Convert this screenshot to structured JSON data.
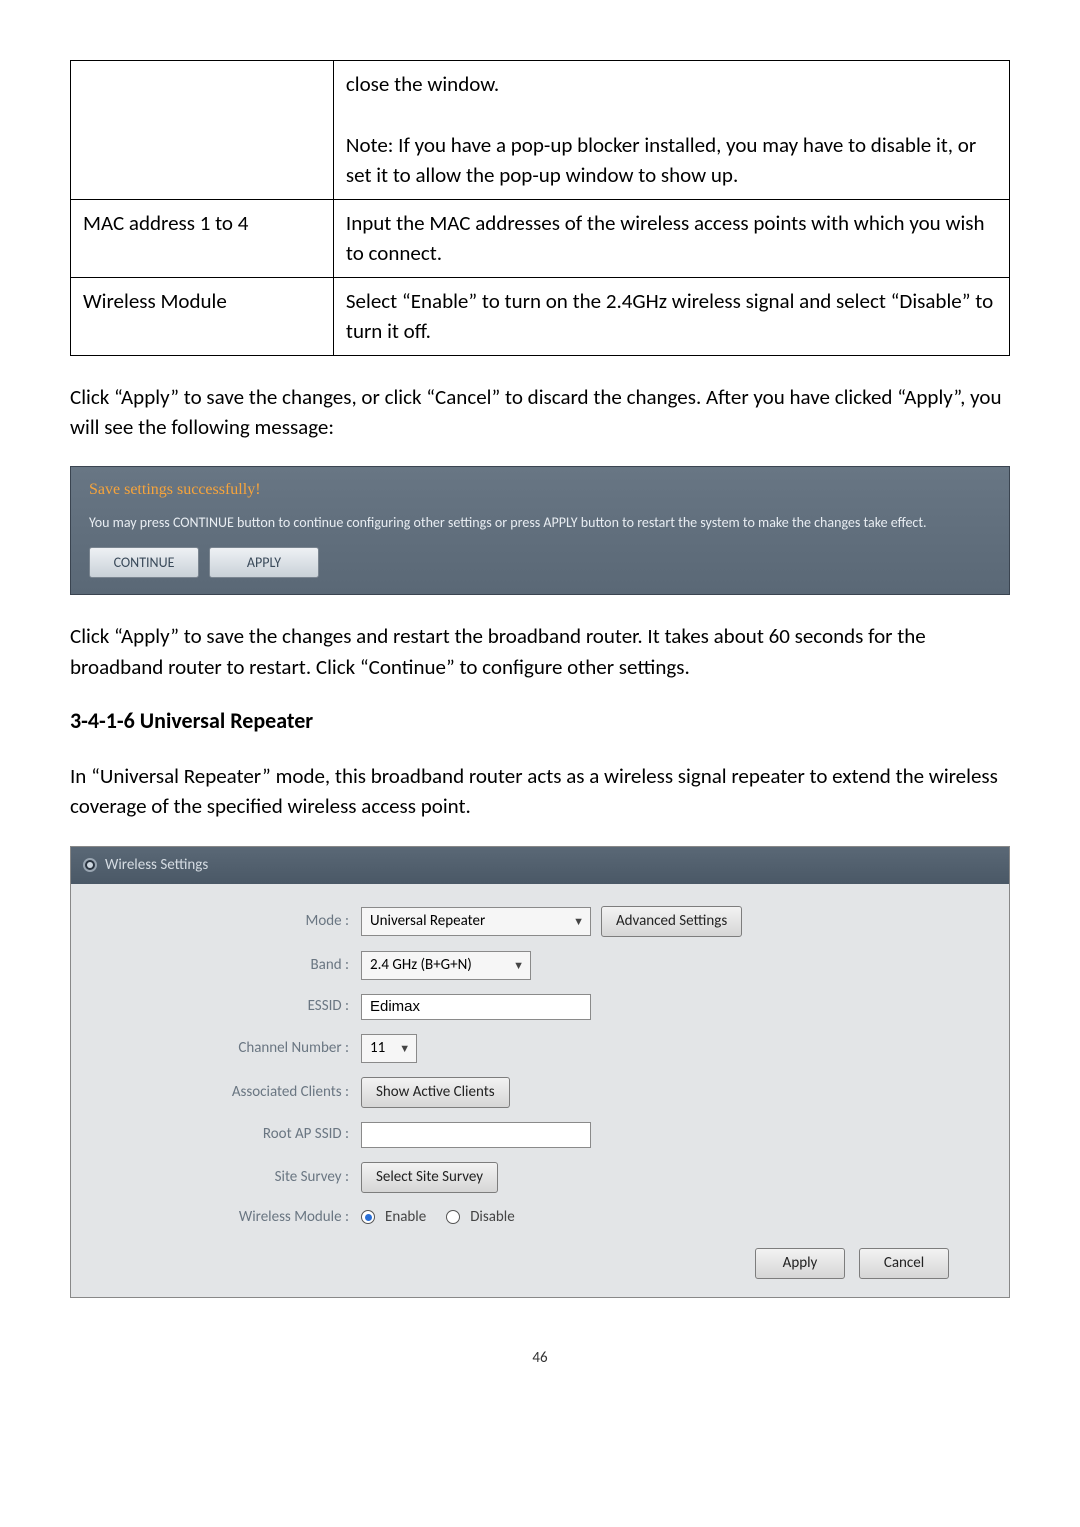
{
  "table": {
    "r1_cont": "close the window.\n\nNote: If you have a pop-up blocker installed, you may have to disable it, or set it to allow the pop-up window to show up.",
    "r2_label": "MAC address 1 to 4",
    "r2_desc": "Input the MAC addresses of the wireless access points with which you wish to connect.",
    "r3_label": "Wireless Module",
    "r3_desc": "Select “Enable” to turn on the 2.4GHz wireless signal and select “Disable” to turn it off."
  },
  "para1": "Click “Apply” to save the changes, or click “Cancel” to discard the changes. After you have clicked “Apply”, you will see the following message:",
  "save_panel": {
    "title": "Save settings successfully!",
    "desc": "You may press CONTINUE button to continue configuring other settings or press APPLY button to restart the system to make the changes take effect.",
    "continue": "CONTINUE",
    "apply": "APPLY"
  },
  "para2": "Click “Apply” to save the changes and restart the broadband router. It takes about 60 seconds for the broadband router to restart. Click “Continue” to configure other settings.",
  "heading": "3-4-1-6 Universal Repeater",
  "para3": "In “Universal Repeater” mode, this broadband router acts as a wireless signal repeater to extend the wireless coverage of the specified wireless access point.",
  "ws": {
    "title": "Wireless Settings",
    "labels": {
      "mode": "Mode :",
      "band": "Band :",
      "essid": "ESSID :",
      "channel": "Channel Number :",
      "assoc": "Associated Clients :",
      "root": "Root AP SSID :",
      "survey": "Site Survey :",
      "module": "Wireless Module :"
    },
    "values": {
      "mode": "Universal Repeater",
      "band": "2.4 GHz (B+G+N)",
      "essid": "Edimax",
      "channel": "11",
      "root": ""
    },
    "buttons": {
      "advanced": "Advanced Settings",
      "show_clients": "Show Active Clients",
      "select_survey": "Select Site Survey",
      "apply": "Apply",
      "cancel": "Cancel"
    },
    "radio": {
      "enable": "Enable",
      "disable": "Disable"
    }
  },
  "page_num": "46"
}
